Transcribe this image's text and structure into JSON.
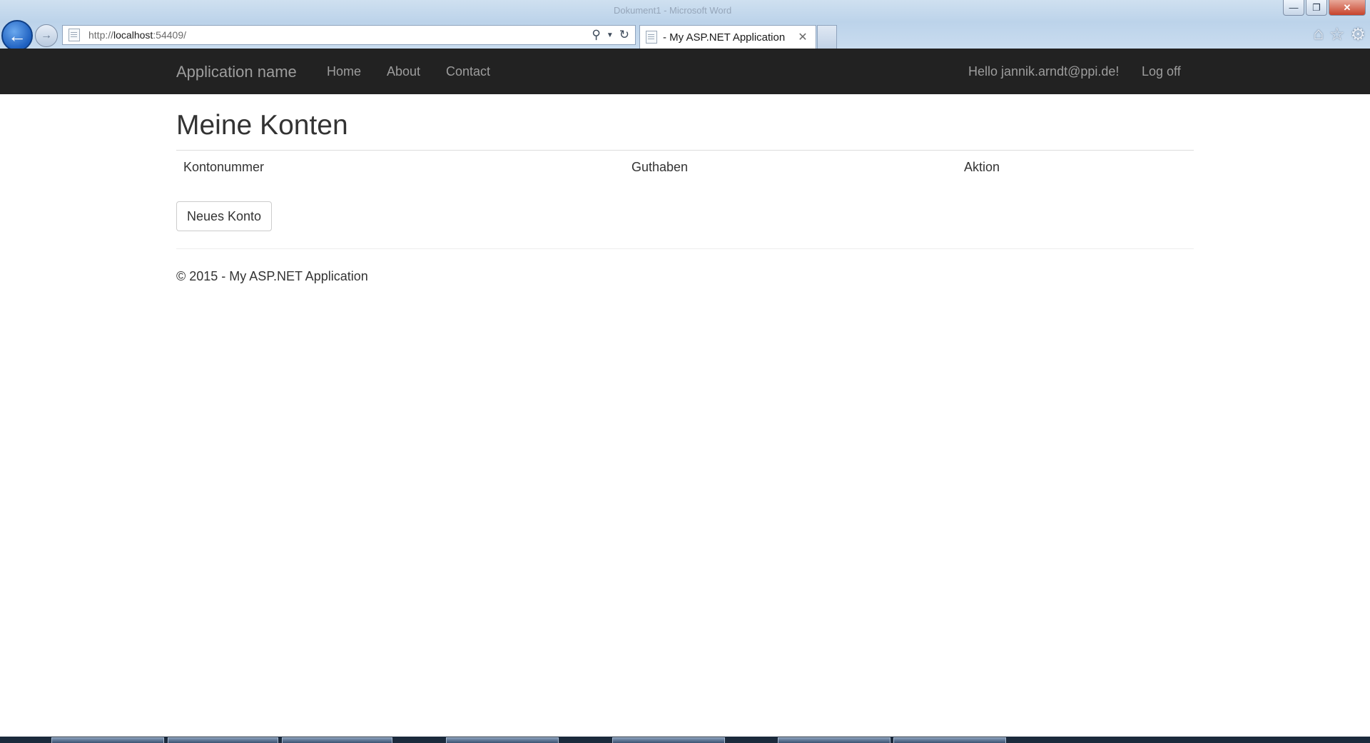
{
  "browser": {
    "ghost_title": "Dokument1 - Microsoft Word",
    "url_prefix": "http://",
    "url_host": "localhost",
    "url_suffix": ":54409/",
    "tab_title": "- My ASP.NET Application",
    "back_icon": "back-arrow-icon",
    "forward_icon": "forward-arrow-icon"
  },
  "navbar": {
    "brand": "Application name",
    "links": [
      "Home",
      "About",
      "Contact"
    ],
    "greeting": "Hello jannik.arndt@ppi.de!",
    "logoff": "Log off"
  },
  "main": {
    "title": "Meine Konten",
    "columns": [
      "Kontonummer",
      "Guthaben",
      "Aktion"
    ],
    "new_account_button": "Neues Konto"
  },
  "footer": {
    "text": "© 2015 - My ASP.NET Application"
  },
  "colors": {
    "navbar_bg": "#222222",
    "navbar_text": "#9d9d9d",
    "body_text": "#333333"
  }
}
